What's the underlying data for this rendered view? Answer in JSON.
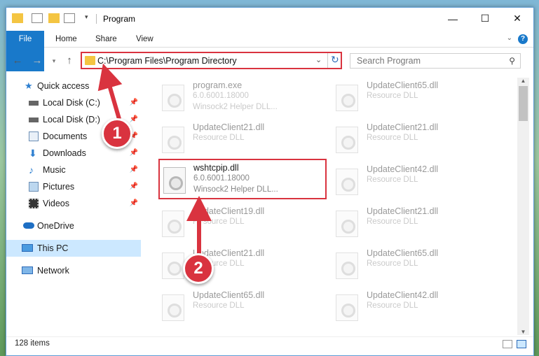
{
  "window": {
    "title": "Program",
    "controls": {
      "minimize": "—",
      "maximize": "☐",
      "close": "✕"
    }
  },
  "ribbon": {
    "tabs": [
      "File",
      "Home",
      "Share",
      "View"
    ],
    "help": "?"
  },
  "navigation": {
    "address": "C:\\Program Files\\Program Directory",
    "search_placeholder": "Search Program"
  },
  "sidebar": {
    "items": [
      {
        "label": "Quick access",
        "icon": "star-icon",
        "pinned": false
      },
      {
        "label": "Local Disk (C:)",
        "icon": "drive-icon",
        "pinned": true
      },
      {
        "label": "Local Disk (D:)",
        "icon": "drive-icon",
        "pinned": true
      },
      {
        "label": "Documents",
        "icon": "documents-icon",
        "pinned": true
      },
      {
        "label": "Downloads",
        "icon": "download-icon",
        "pinned": true
      },
      {
        "label": "Music",
        "icon": "music-icon",
        "pinned": true
      },
      {
        "label": "Pictures",
        "icon": "pictures-icon",
        "pinned": true
      },
      {
        "label": "Videos",
        "icon": "videos-icon",
        "pinned": true
      },
      {
        "label": "OneDrive",
        "icon": "cloud-icon",
        "pinned": false
      },
      {
        "label": "This PC",
        "icon": "computer-icon",
        "pinned": false,
        "selected": true
      },
      {
        "label": "Network",
        "icon": "network-icon",
        "pinned": false
      }
    ]
  },
  "files": [
    {
      "name": "program.exe",
      "line2": "6.0.6001.18000",
      "line3": "Winsock2 Helper DLL...",
      "faded": true
    },
    {
      "name": "UpdateClient65.dll",
      "line2": "Resource DLL",
      "line3": "",
      "faded": true
    },
    {
      "name": "UpdateClient21.dll",
      "line2": "Resource DLL",
      "line3": "",
      "faded": true
    },
    {
      "name": "UpdateClient21.dll",
      "line2": "Resource DLL",
      "line3": "",
      "faded": true
    },
    {
      "name": "wshtcpip.dll",
      "line2": "6.0.6001.18000",
      "line3": "Winsock2 Helper DLL...",
      "faded": false,
      "highlighted": true
    },
    {
      "name": "UpdateClient42.dll",
      "line2": "Resource DLL",
      "line3": "",
      "faded": true
    },
    {
      "name": "UpdateClient19.dll",
      "line2": "Resource DLL",
      "line3": "",
      "faded": true
    },
    {
      "name": "UpdateClient21.dll",
      "line2": "Resource DLL",
      "line3": "",
      "faded": true
    },
    {
      "name": "UpdateClient21.dll",
      "line2": "Resource DLL",
      "line3": "",
      "faded": true
    },
    {
      "name": "UpdateClient65.dll",
      "line2": "Resource DLL",
      "line3": "",
      "faded": true
    },
    {
      "name": "UpdateClient65.dll",
      "line2": "Resource DLL",
      "line3": "",
      "faded": true
    },
    {
      "name": "UpdateClient42.dll",
      "line2": "Resource DLL",
      "line3": "",
      "faded": true
    },
    {
      "name": "",
      "line2": "",
      "line3": "",
      "faded": true
    },
    {
      "name": "",
      "line2": "",
      "line3": "",
      "faded": true
    }
  ],
  "status": {
    "item_count": "128 items"
  },
  "annotations": {
    "step1": "1",
    "step2": "2",
    "color": "#d9333f"
  }
}
